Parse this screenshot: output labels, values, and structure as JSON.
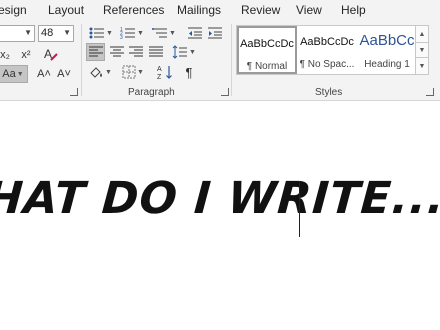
{
  "tabs": [
    "esign",
    "Layout",
    "References",
    "Mailings",
    "Review",
    "View",
    "Help"
  ],
  "font": {
    "size_value": "48"
  },
  "format_buttons": {
    "subscript": "x₂",
    "superscript": "x²",
    "change_case": "Aa",
    "grow_font": "A˄",
    "shrink_font": "A˅"
  },
  "paragraph": {
    "label": "Paragraph",
    "show_marks": "¶"
  },
  "styles": {
    "label": "Styles",
    "items": [
      {
        "preview": "AaBbCcDc",
        "name": "¶ Normal",
        "selected": true
      },
      {
        "preview": "AaBbCcDc",
        "name": "¶ No Spac...",
        "selected": false
      },
      {
        "preview": "AaBbCc",
        "name": "Heading 1",
        "selected": false,
        "color": "#2f5496"
      }
    ]
  },
  "document": {
    "text": "HAT DO I WRITE..."
  },
  "icons": [
    "bullets-icon",
    "numbering-icon",
    "multilevel-list-icon",
    "decrease-indent-icon",
    "increase-indent-icon",
    "align-left-icon",
    "center-icon",
    "align-right-icon",
    "justify-icon",
    "line-spacing-icon",
    "shading-icon",
    "borders-icon",
    "sort-icon",
    "show-marks-icon",
    "clear-formatting-icon"
  ],
  "colors": {
    "ribbon_bg": "#f3f3f3",
    "heading_blue": "#2f5496",
    "selected_btn": "#c5c5c5"
  }
}
